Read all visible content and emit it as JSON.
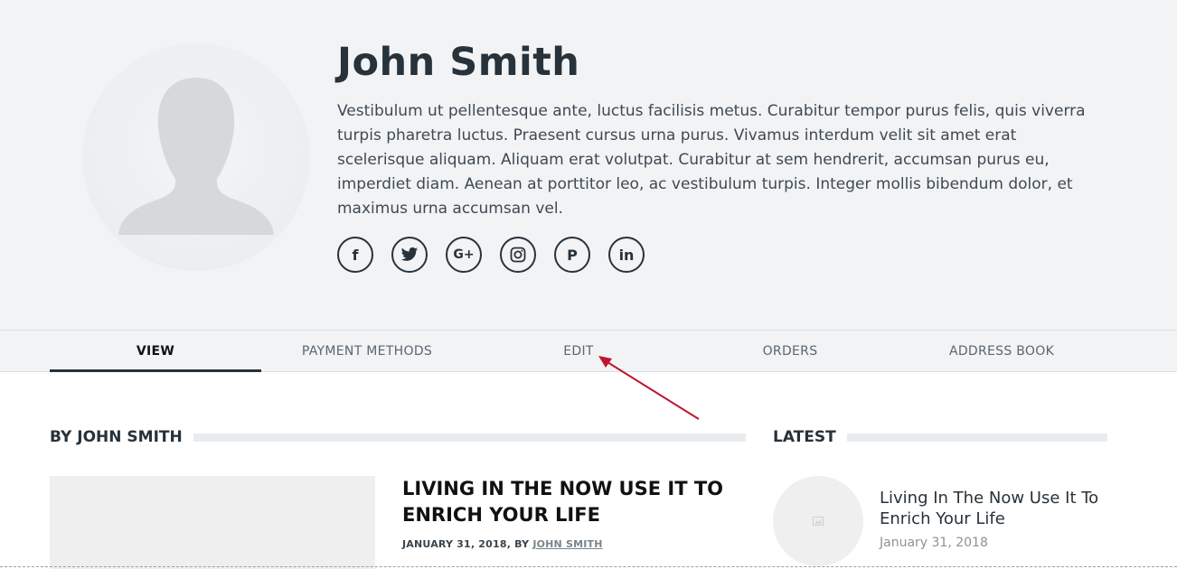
{
  "profile": {
    "name": "John Smith",
    "bio": "Vestibulum ut pellentesque ante, luctus facilisis metus. Curabitur tempor purus felis, quis viverra turpis pharetra luctus. Praesent cursus urna purus. Vivamus interdum velit sit amet erat scelerisque aliquam. Aliquam erat volutpat. Curabitur at sem hendrerit, accumsan purus eu, imperdiet diam. Aenean at porttitor leo, ac vestibulum turpis. Integer mollis bibendum dolor, et maximus urna accumsan vel.",
    "socials": [
      {
        "icon": "facebook-icon",
        "glyph": "f"
      },
      {
        "icon": "twitter-icon",
        "glyph": "🐦"
      },
      {
        "icon": "google-plus-icon",
        "glyph": "G+"
      },
      {
        "icon": "instagram-icon",
        "glyph": "◎"
      },
      {
        "icon": "pinterest-icon",
        "glyph": "P"
      },
      {
        "icon": "linkedin-icon",
        "glyph": "in"
      }
    ]
  },
  "tabs": [
    {
      "label": "VIEW",
      "active": true
    },
    {
      "label": "PAYMENT METHODS",
      "active": false
    },
    {
      "label": "EDIT",
      "active": false
    },
    {
      "label": "ORDERS",
      "active": false
    },
    {
      "label": "ADDRESS BOOK",
      "active": false
    }
  ],
  "by_section": {
    "heading": "BY JOHN SMITH",
    "post": {
      "title": "LIVING IN THE NOW USE IT TO ENRICH YOUR LIFE",
      "meta_prefix": "JANUARY 31, 2018, BY ",
      "author": "JOHN SMITH"
    }
  },
  "latest_section": {
    "heading": "LATEST",
    "item": {
      "title": "Living In The Now Use It To Enrich Your Life",
      "date": "January 31, 2018"
    }
  },
  "annotation": {
    "arrow_color": "#c0152f"
  },
  "colors": {
    "hero_bg": "#f2f3f5",
    "text_dark": "#27323a"
  }
}
